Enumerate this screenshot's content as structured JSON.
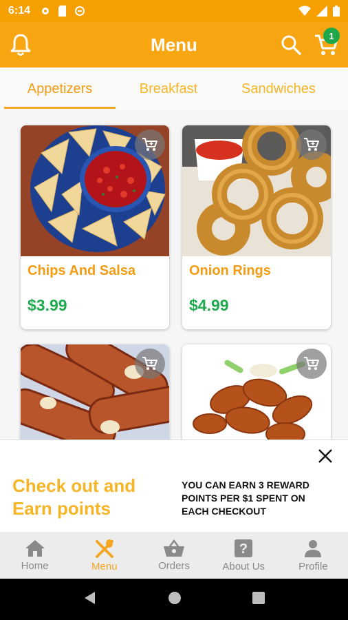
{
  "status_bar": {
    "time": "6:14"
  },
  "app_bar": {
    "title": "Menu",
    "cart_count": "1"
  },
  "tabs": [
    {
      "label": "Appetizers",
      "active": true
    },
    {
      "label": "Breakfast",
      "active": false
    },
    {
      "label": "Sandwiches",
      "active": false
    }
  ],
  "items": [
    {
      "name": "Chips And Salsa",
      "price": "$3.99"
    },
    {
      "name": "Onion Rings",
      "price": "$4.99"
    },
    {
      "name": "",
      "price": ""
    },
    {
      "name": "",
      "price": ""
    }
  ],
  "banner": {
    "headline": "Check out and Earn points",
    "info": "YOU CAN EARN 3 REWARD POINTS PER $1 SPENT ON EACH CHECKOUT"
  },
  "bottom_nav": [
    {
      "label": "Home",
      "icon": "home-icon",
      "active": false
    },
    {
      "label": "Menu",
      "icon": "utensils-icon",
      "active": true
    },
    {
      "label": "Orders",
      "icon": "basket-icon",
      "active": false
    },
    {
      "label": "About Us",
      "icon": "help-icon",
      "active": false
    },
    {
      "label": "Profile",
      "icon": "person-icon",
      "active": false
    }
  ],
  "colors": {
    "accent": "#f8a512",
    "price_green": "#1faa4f",
    "badge_green": "#1ea84a"
  }
}
